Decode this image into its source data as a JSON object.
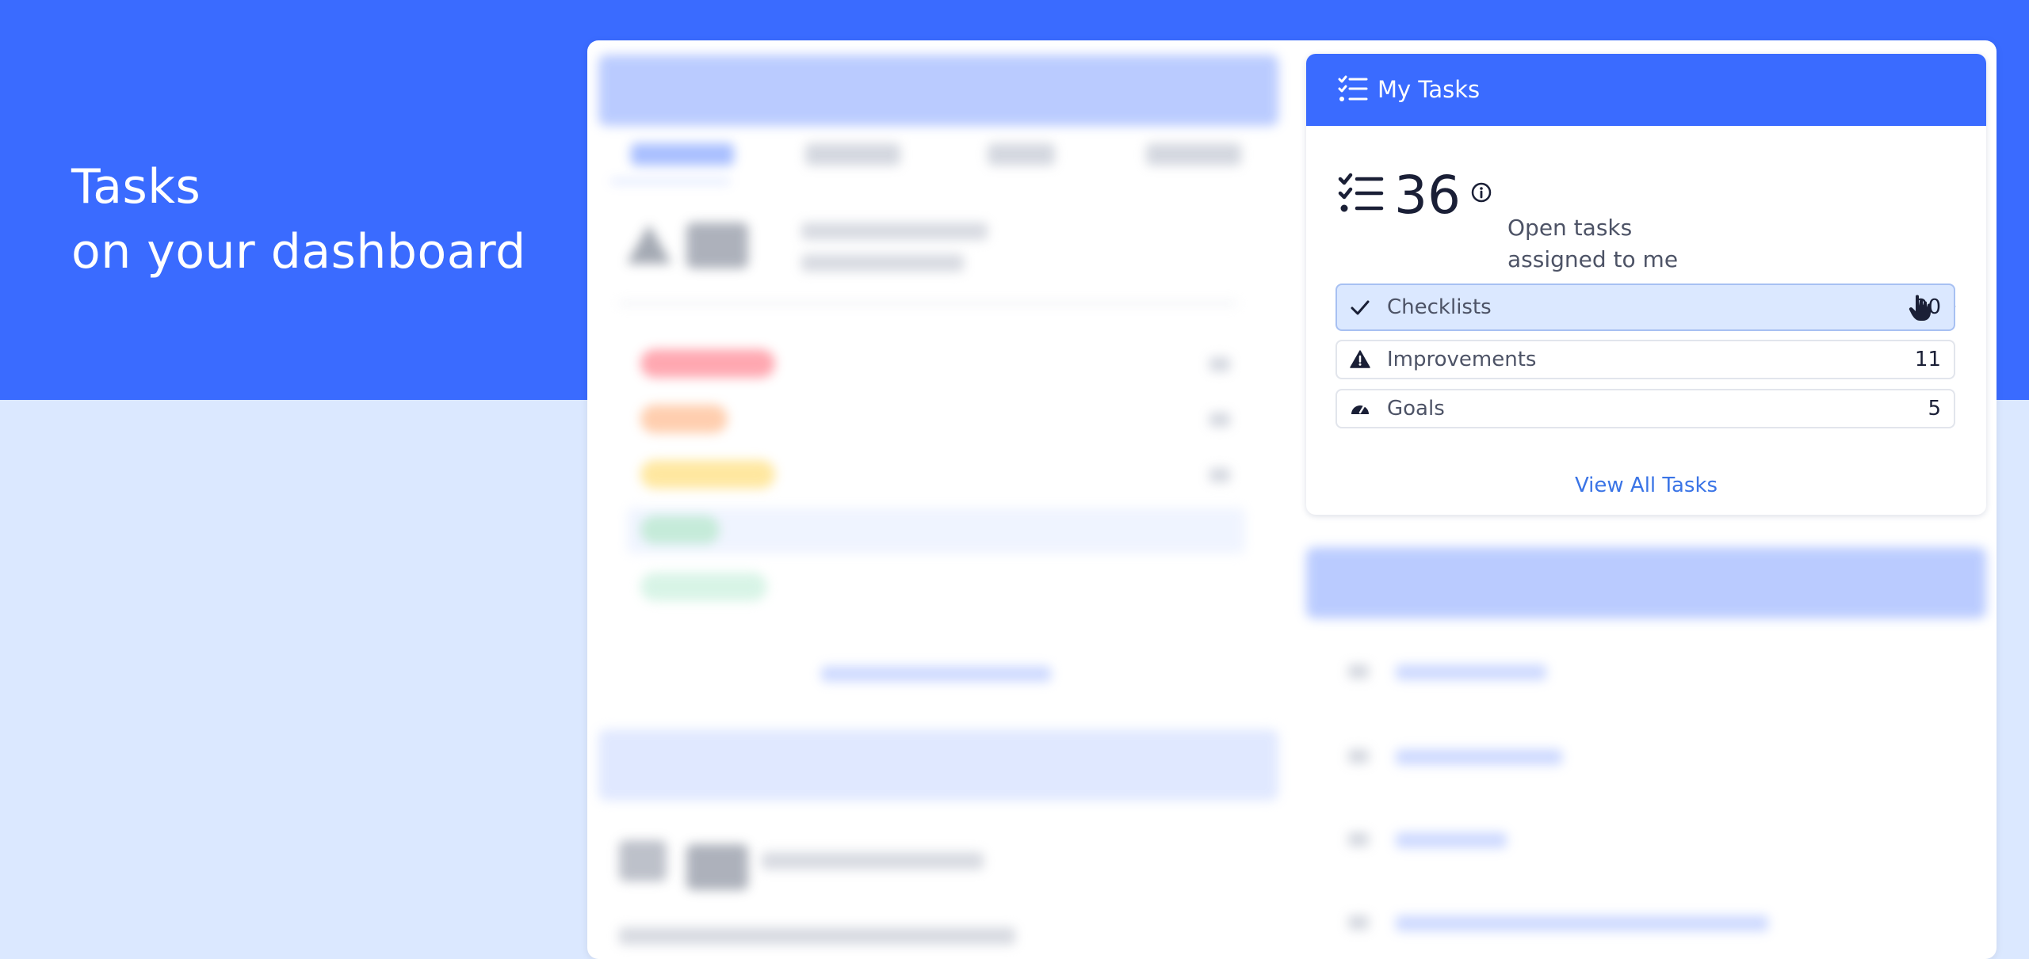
{
  "hero": {
    "line1": "Tasks",
    "line2": "on your dashboard"
  },
  "colors": {
    "brand": "#3a6bff",
    "page_bg": "#dbe8ff",
    "highlight_row": "#dbe8ff",
    "link": "#3a74e6"
  },
  "tasks_widget": {
    "title": "My Tasks",
    "header_icon": "checklist-icon",
    "summary": {
      "icon": "checklist-icon",
      "count": "36",
      "info_icon": "info-circle-icon",
      "description_line1": "Open tasks",
      "description_line2": "assigned to me"
    },
    "rows": [
      {
        "icon": "check-icon",
        "label": "Checklists",
        "count": "20",
        "highlighted": true
      },
      {
        "icon": "warning-triangle-icon",
        "label": "Improvements",
        "count": "11",
        "highlighted": false
      },
      {
        "icon": "gauge-icon",
        "label": "Goals",
        "count": "5",
        "highlighted": false
      }
    ],
    "cursor_icon": "hand-pointer-icon",
    "view_all_label": "View All Tasks"
  }
}
